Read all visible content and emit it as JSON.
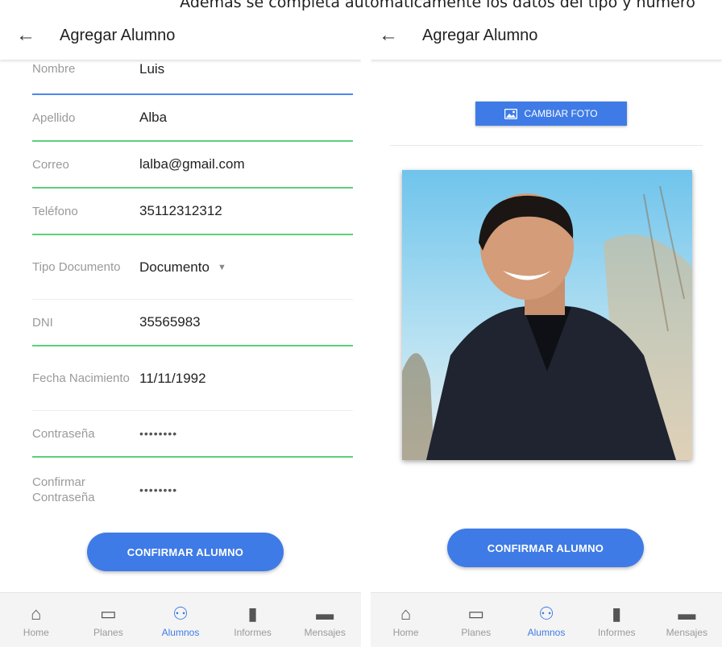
{
  "caption": "Además se completa automáticamente los datos del tipo y número",
  "colors": {
    "primary": "#3f7be6",
    "valid_line": "#5ad17c",
    "focus_line": "#4d87ee"
  },
  "left": {
    "appbar": {
      "back_icon": "arrow-left-icon",
      "back_glyph": "←",
      "title": "Agregar Alumno"
    },
    "fields": [
      {
        "label": "Nombre",
        "value": "Luis"
      },
      {
        "label": "Apellido",
        "value": "Alba"
      },
      {
        "label": "Correo",
        "value": "lalba@gmail.com"
      },
      {
        "label": "Teléfono",
        "value": "35112312312"
      },
      {
        "label": "Tipo Documento",
        "value": "Documento",
        "dropdown_icon": "▼"
      },
      {
        "label": "DNI",
        "value": "35565983"
      },
      {
        "label": "Fecha Nacimiento",
        "value": "11/11/1992"
      },
      {
        "label": "Contraseña",
        "value": "••••••••"
      },
      {
        "label": "Confirmar Contraseña",
        "value": "••••••••"
      }
    ],
    "confirm_button": "CONFIRMAR ALUMNO"
  },
  "right": {
    "appbar": {
      "back_icon": "arrow-left-icon",
      "back_glyph": "←",
      "title": "Agregar Alumno"
    },
    "change_photo_button": "CAMBIAR FOTO",
    "confirm_button": "CONFIRMAR ALUMNO"
  },
  "nav": [
    {
      "label": "Home",
      "icon": "home-icon",
      "glyph": "⌂"
    },
    {
      "label": "Planes",
      "icon": "clipboard-icon",
      "glyph": "▭"
    },
    {
      "label": "Alumnos",
      "icon": "students-icon",
      "glyph": "⚇",
      "active": true
    },
    {
      "label": "Informes",
      "icon": "bar-chart-icon",
      "glyph": "▮"
    },
    {
      "label": "Mensajes",
      "icon": "chat-icon",
      "glyph": "▬"
    }
  ]
}
